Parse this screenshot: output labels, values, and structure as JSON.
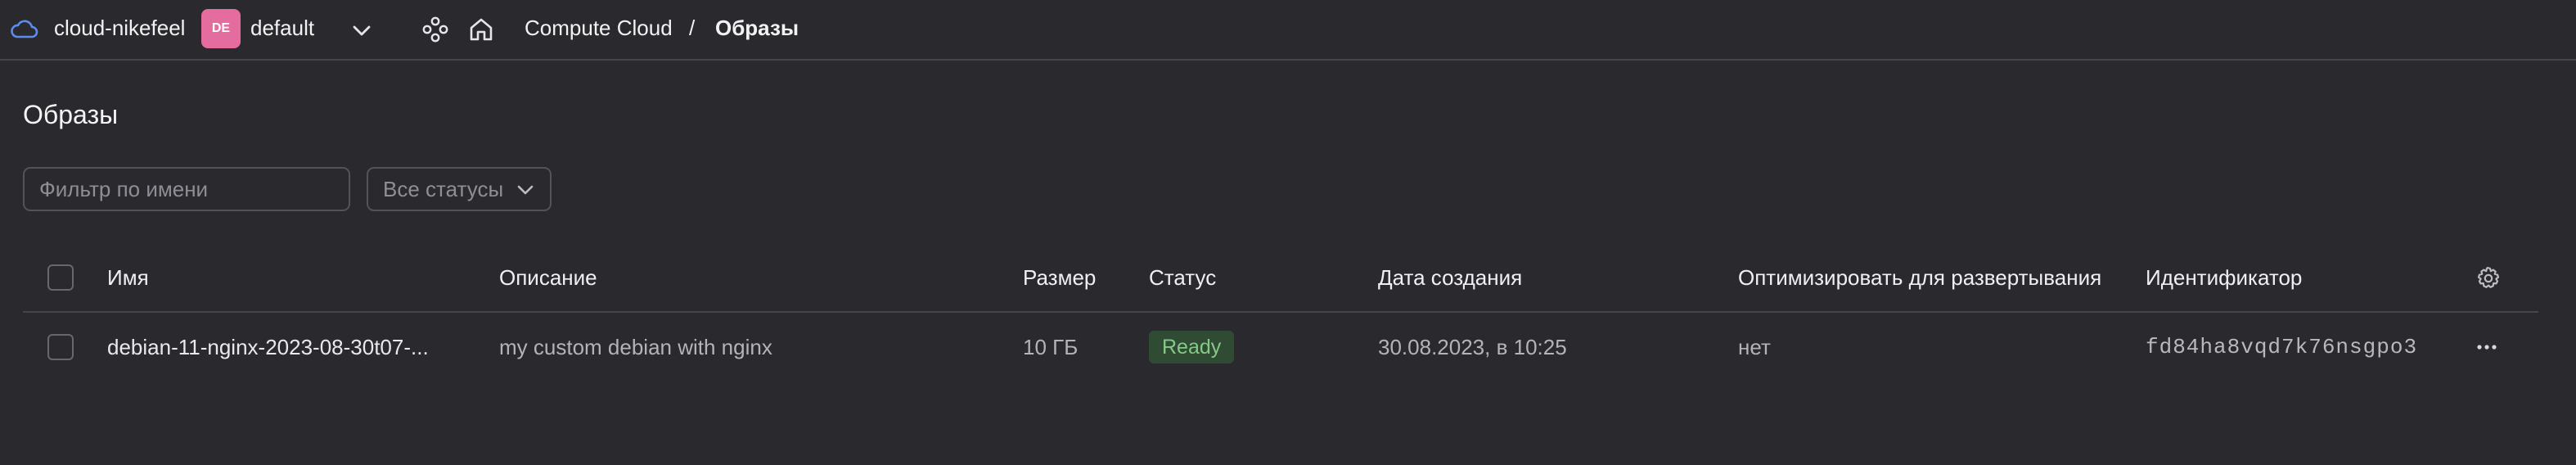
{
  "header": {
    "cloud_name": "cloud-nikefeel",
    "folder_badge": "DE",
    "folder_name": "default",
    "breadcrumb": {
      "service": "Compute Cloud",
      "separator": "/",
      "current": "Образы"
    }
  },
  "page": {
    "title": "Образы",
    "filter_placeholder": "Фильтр по имени",
    "status_select": "Все статусы"
  },
  "table": {
    "columns": {
      "name": "Имя",
      "description": "Описание",
      "size": "Размер",
      "status": "Статус",
      "created": "Дата создания",
      "optimize": "Оптимизировать для развертывания",
      "id": "Идентификатор"
    },
    "rows": [
      {
        "name": "debian-11-nginx-2023-08-30t07-...",
        "description": "my custom debian with nginx",
        "size": "10 ГБ",
        "status": "Ready",
        "created": "30.08.2023, в 10:25",
        "optimize": "нет",
        "id": "fd84ha8vqd7k76nsgpo3"
      }
    ]
  },
  "colors": {
    "background": "#2a292e",
    "accent_avatar": "#e46c9f",
    "status_ready_bg": "#2f4b33",
    "status_ready_text": "#86c986",
    "cloud_icon": "#5b8def"
  },
  "icons": [
    "cloud-icon",
    "chevron-down-icon",
    "services-icon",
    "home-icon",
    "gear-icon",
    "more-icon"
  ]
}
